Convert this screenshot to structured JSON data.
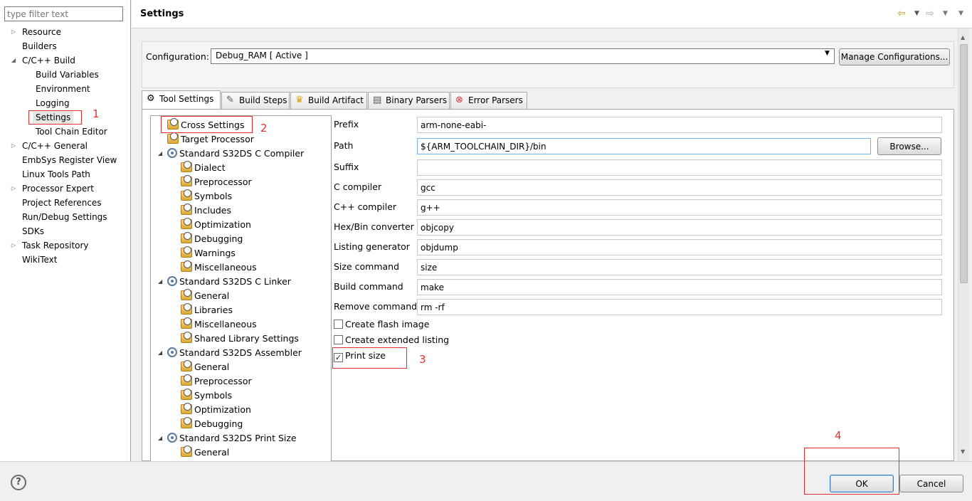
{
  "filter": {
    "placeholder": "type filter text"
  },
  "nav": {
    "items": [
      {
        "label": "Resource"
      },
      {
        "label": "Builders"
      },
      {
        "label": "C/C++ Build"
      },
      {
        "label": "Build Variables"
      },
      {
        "label": "Environment"
      },
      {
        "label": "Logging"
      },
      {
        "label": "Settings"
      },
      {
        "label": "Tool Chain Editor"
      },
      {
        "label": "C/C++ General"
      },
      {
        "label": "EmbSys Register View"
      },
      {
        "label": "Linux Tools Path"
      },
      {
        "label": "Processor Expert"
      },
      {
        "label": "Project References"
      },
      {
        "label": "Run/Debug Settings"
      },
      {
        "label": "SDKs"
      },
      {
        "label": "Task Repository"
      },
      {
        "label": "WikiText"
      }
    ]
  },
  "header": {
    "title": "Settings"
  },
  "config": {
    "label": "Configuration:",
    "value": "Debug_RAM  [ Active ]",
    "manage_button": "Manage Configurations..."
  },
  "tabs": [
    {
      "label": "Tool Settings"
    },
    {
      "label": "Build Steps"
    },
    {
      "label": "Build Artifact"
    },
    {
      "label": "Binary Parsers"
    },
    {
      "label": "Error Parsers"
    }
  ],
  "tree": {
    "items": [
      {
        "label": "Cross Settings"
      },
      {
        "label": "Target Processor"
      },
      {
        "label": "Standard S32DS C Compiler"
      },
      {
        "label": "Dialect"
      },
      {
        "label": "Preprocessor"
      },
      {
        "label": "Symbols"
      },
      {
        "label": "Includes"
      },
      {
        "label": "Optimization"
      },
      {
        "label": "Debugging"
      },
      {
        "label": "Warnings"
      },
      {
        "label": "Miscellaneous"
      },
      {
        "label": "Standard S32DS C Linker"
      },
      {
        "label": "General"
      },
      {
        "label": "Libraries"
      },
      {
        "label": "Miscellaneous"
      },
      {
        "label": "Shared Library Settings"
      },
      {
        "label": "Standard S32DS Assembler"
      },
      {
        "label": "General"
      },
      {
        "label": "Preprocessor"
      },
      {
        "label": "Symbols"
      },
      {
        "label": "Optimization"
      },
      {
        "label": "Debugging"
      },
      {
        "label": "Standard S32DS Print Size"
      },
      {
        "label": "General"
      }
    ]
  },
  "form": {
    "fields": [
      {
        "label": "Prefix",
        "value": "arm-none-eabi-"
      },
      {
        "label": "Path",
        "value": "${ARM_TOOLCHAIN_DIR}/bin"
      },
      {
        "label": "Suffix",
        "value": ""
      },
      {
        "label": "C compiler",
        "value": "gcc"
      },
      {
        "label": "C++ compiler",
        "value": "g++"
      },
      {
        "label": "Hex/Bin converter",
        "value": "objcopy"
      },
      {
        "label": "Listing generator",
        "value": "objdump"
      },
      {
        "label": "Size command",
        "value": "size"
      },
      {
        "label": "Build command",
        "value": "make"
      },
      {
        "label": "Remove command",
        "value": "rm -rf"
      }
    ],
    "browse_button": "Browse...",
    "checks": [
      {
        "label": "Create flash image",
        "checked": false
      },
      {
        "label": "Create extended listing",
        "checked": false
      },
      {
        "label": "Print size",
        "checked": true
      }
    ]
  },
  "annotations": [
    "1",
    "2",
    "3",
    "4"
  ],
  "footer": {
    "help": "?",
    "ok": "OK",
    "cancel": "Cancel"
  },
  "icons": {
    "check_mark": "✓"
  }
}
